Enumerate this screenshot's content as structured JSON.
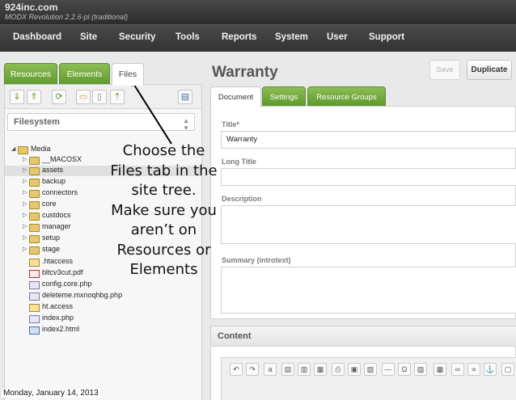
{
  "brand": {
    "domain": "924inc.com",
    "version": "MODX Revolution 2.2.6-pl (traditional)"
  },
  "nav": [
    "Dashboard",
    "Site",
    "Security",
    "Tools",
    "Reports",
    "System",
    "User",
    "Support"
  ],
  "left_tabs": [
    "Resources",
    "Elements",
    "Files"
  ],
  "filesystem_select": "Filesystem",
  "tree": [
    "Media",
    "__MACOSX",
    "assets",
    "backup",
    "connectors",
    "core",
    "custdocs",
    "manager",
    "setup",
    "stage",
    ".htaccess",
    "bltcv3cut.pdf",
    "config.core.php",
    "deleteme.mxnoqhbg.php",
    "ht.access",
    "index.php",
    "index2.html"
  ],
  "page_title": "Warranty",
  "buttons": {
    "save": "Save",
    "duplicate": "Duplicate"
  },
  "right_tabs": [
    "Document",
    "Settings",
    "Resource Groups"
  ],
  "form": {
    "title_label": "Title*",
    "title_value": "Warranty",
    "long_title_label": "Long Title",
    "description_label": "Description",
    "summary_label": "Summary (introtext)"
  },
  "content_label": "Content",
  "annotation": [
    "Choose the",
    "Files tab in the",
    "site tree.",
    "Make sure you",
    "aren’t on",
    "Resources or",
    "Elements"
  ],
  "footer_date": "Monday, January 14, 2013",
  "colors": {
    "accent_green": "#6aa338",
    "nav_dark": "#333333"
  }
}
